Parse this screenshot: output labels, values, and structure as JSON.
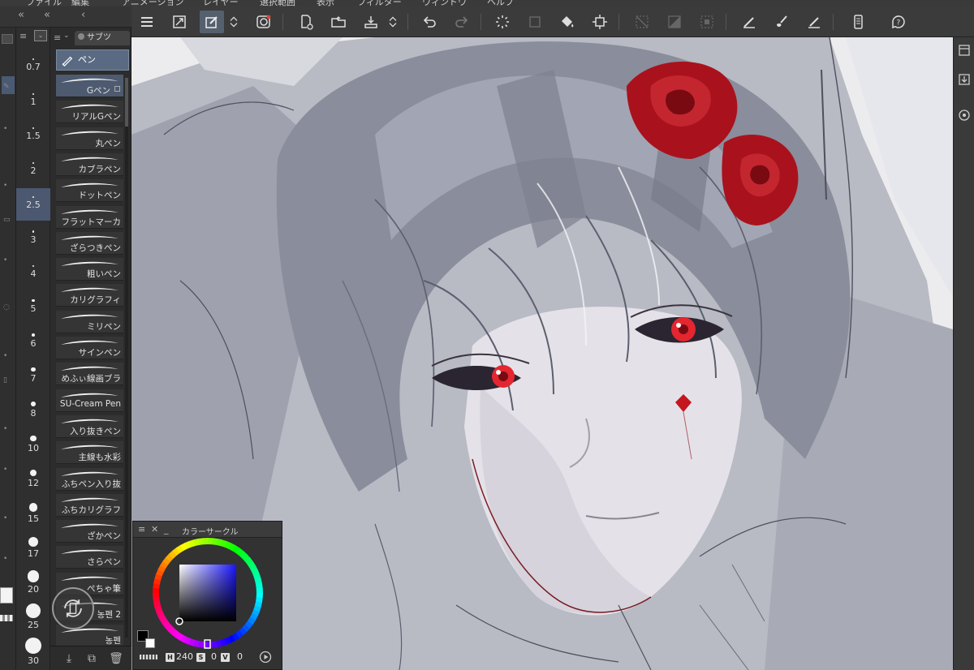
{
  "menu": {
    "items": [
      "ファイル",
      "編集",
      "アニメーション",
      "レイヤー",
      "選択範囲",
      "表示",
      "フィルター",
      "ウィンドウ",
      "ヘルプ"
    ]
  },
  "sub_tool": {
    "tab_label": "サブツ",
    "group_label": "ペン",
    "brushes": [
      {
        "name": "Gペン",
        "selected": true
      },
      {
        "name": "リアルGペン"
      },
      {
        "name": "丸ペン"
      },
      {
        "name": "カブラペン"
      },
      {
        "name": "ドットペン"
      },
      {
        "name": "フラットマーカ"
      },
      {
        "name": "ざらつきペン"
      },
      {
        "name": "粗いペン"
      },
      {
        "name": "カリグラフィ"
      },
      {
        "name": "ミリペン"
      },
      {
        "name": "サインペン"
      },
      {
        "name": "めふぃ線画ブラ"
      },
      {
        "name": "SU-Cream Pen"
      },
      {
        "name": "入り抜きペン"
      },
      {
        "name": "主線も水彩"
      },
      {
        "name": "ふちペン入り抜"
      },
      {
        "name": "ふちカリグラフ"
      },
      {
        "name": "ざかペン"
      },
      {
        "name": "さらペン"
      },
      {
        "name": "ぺちゃ筆"
      },
      {
        "name": "농펜 2"
      },
      {
        "name": "농펜"
      }
    ]
  },
  "brush_size": {
    "sizes": [
      "0.7",
      "1",
      "1.5",
      "2",
      "2.5",
      "3",
      "4",
      "5",
      "6",
      "7",
      "8",
      "10",
      "12",
      "15",
      "17",
      "20",
      "25",
      "30"
    ],
    "selected": "2.5"
  },
  "color_circle": {
    "title": "カラーサークル",
    "h_key": "H",
    "h_value": "240",
    "s_key": "S",
    "s_value": "0",
    "v_key": "V",
    "v_value": "0",
    "main_color": "#000000",
    "sub_color": "#ffffff"
  },
  "colors": {
    "accent": "#5a6a82",
    "toolbar_bg": "#3b3b3b",
    "panel_bg": "#2c2c2c"
  }
}
